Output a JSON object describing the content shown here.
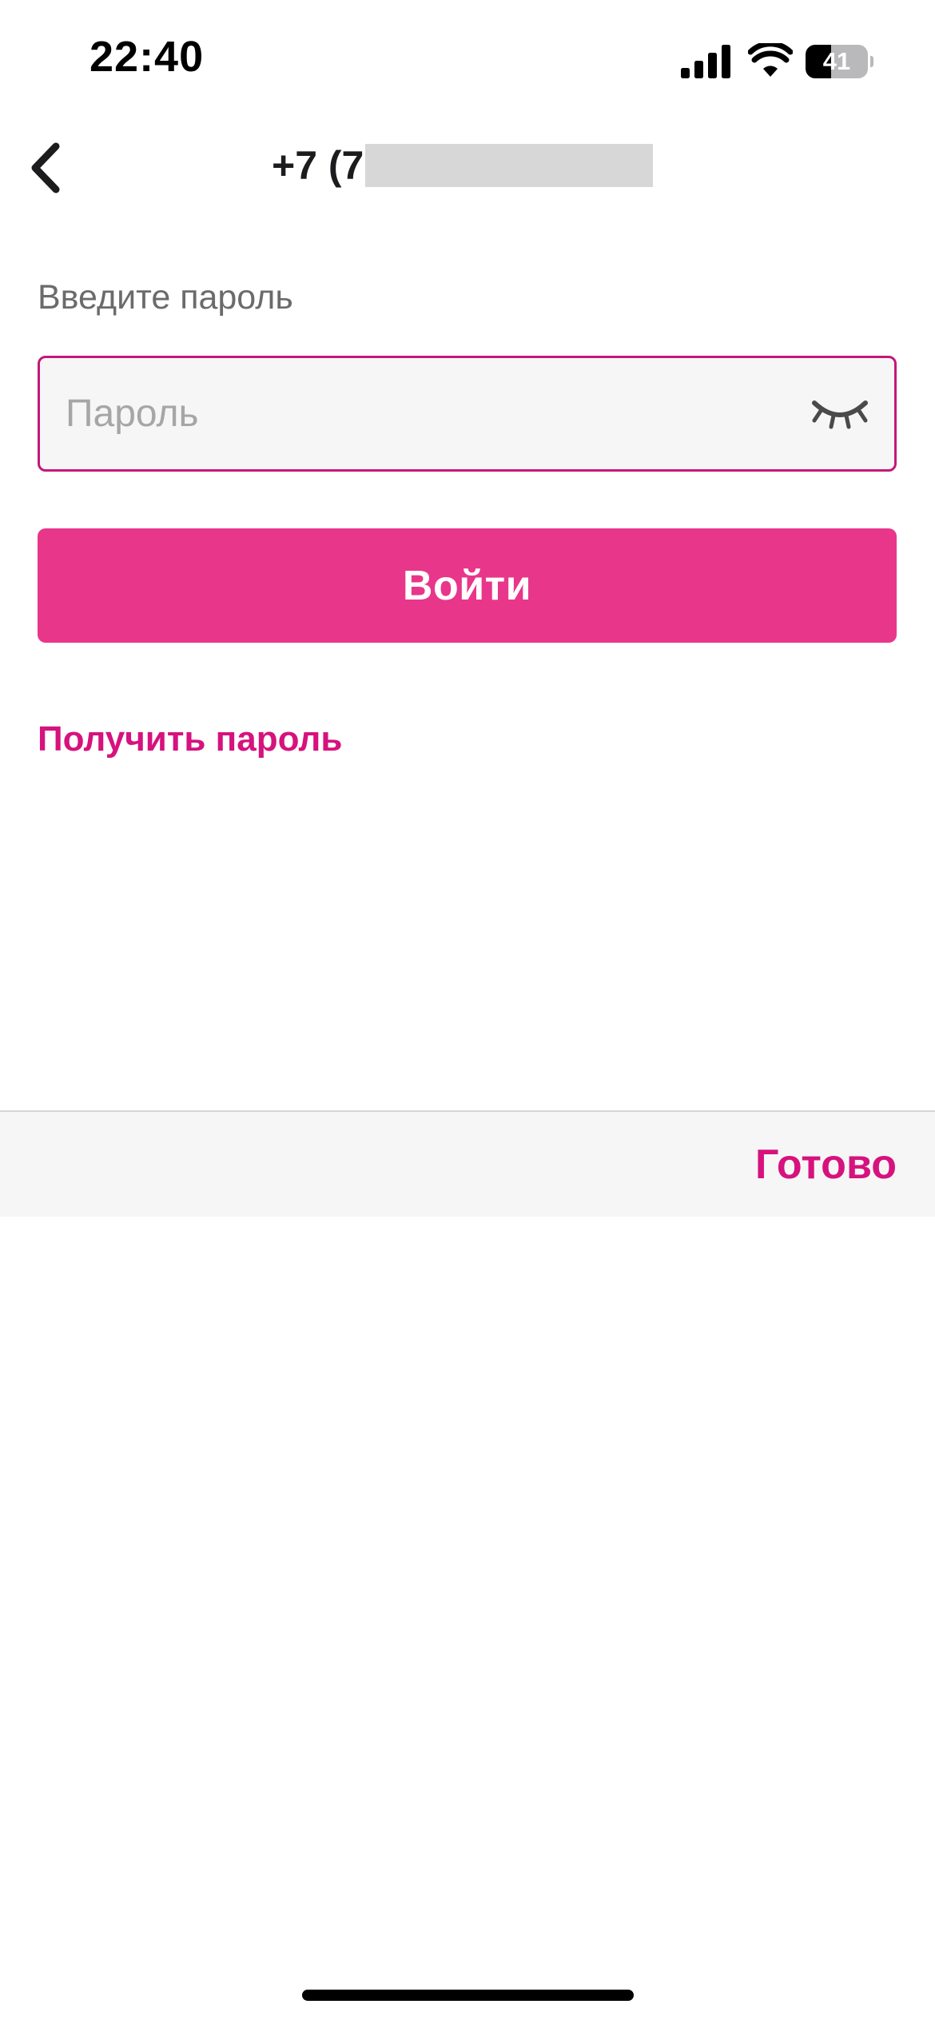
{
  "status_bar": {
    "time": "22:40",
    "battery_percent": 41,
    "battery_label": "41"
  },
  "nav": {
    "back_icon": "chevron-left-icon",
    "phone_visible_prefix": "+7 (7"
  },
  "form": {
    "label": "Введите пароль",
    "password_value": "",
    "password_placeholder": "Пароль",
    "eye_icon": "eye-closed-icon",
    "login_button_label": "Войти",
    "get_password_link": "Получить пароль"
  },
  "keyboard_toolbar": {
    "done_label": "Готово"
  },
  "colors": {
    "accent": "#e8368a",
    "accent_text": "#d6127e",
    "field_border": "#c2187a",
    "field_background": "#f6f6f6",
    "label_gray": "#6b6b6b",
    "placeholder_gray": "#a6a6a6"
  }
}
